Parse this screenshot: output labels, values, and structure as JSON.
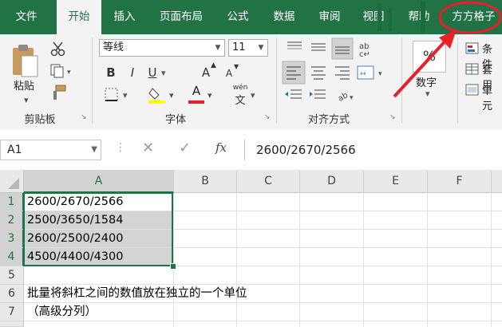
{
  "tabs": [
    "文件",
    "开始",
    "插入",
    "页面布局",
    "公式",
    "数据",
    "审阅",
    "视图",
    "帮助",
    "方方格子"
  ],
  "active_tab": "开始",
  "clipboard": {
    "paste_label": "粘贴",
    "group_label": "剪贴板"
  },
  "font": {
    "name": "等线",
    "size": "11",
    "group_label": "字体",
    "grow_icon_text": "A",
    "shrink_icon_text": "A",
    "bold": "B",
    "italic": "I",
    "underline": "U",
    "font_color_text": "A",
    "phonetic_text": "wén"
  },
  "alignment": {
    "group_label": "对齐方式"
  },
  "number": {
    "format_symbol": "%",
    "label": "数字"
  },
  "styles": {
    "items": [
      "条件",
      "套用",
      "单元"
    ]
  },
  "formula_bar": {
    "name_box": "A1",
    "fx_label": "fx",
    "content": "2600/2670/2566"
  },
  "grid": {
    "columns": [
      "A",
      "B",
      "C",
      "D",
      "E",
      "F"
    ],
    "rows": [
      "1",
      "2",
      "3",
      "4",
      "5",
      "6",
      "7"
    ],
    "cells": {
      "A1": "2600/2670/2566",
      "A2": "2500/3650/1584",
      "A3": "2600/2500/2400",
      "A4": "4500/4400/4300",
      "A6": "批量将斜杠之间的数值放在独立的一个单位",
      "A7": "（高级分列）"
    }
  },
  "colors": {
    "ribbon_green": "#217346",
    "annotation_red": "#e8202a",
    "font_color_bar": "#e8202a",
    "highlight_bar": "#ffff00"
  }
}
